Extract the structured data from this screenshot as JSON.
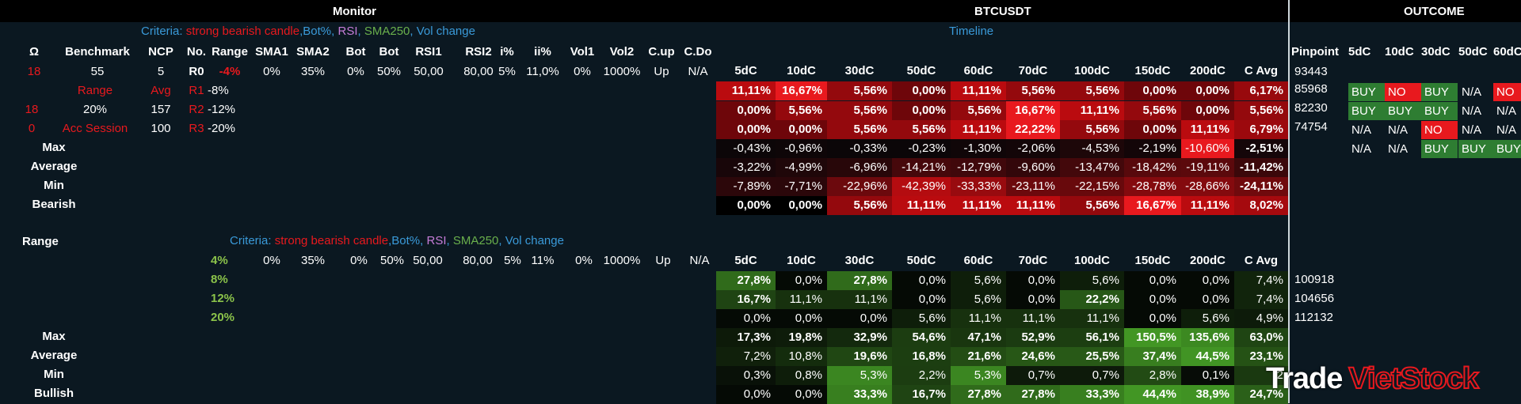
{
  "titles": {
    "monitor": "Monitor",
    "symbol": "BTCUSDT",
    "outcome": "OUTCOME",
    "timeline": "Timeline"
  },
  "criteria": {
    "prefix": "Criteria: ",
    "strong": "strong bearish candle",
    "bot": ",Bot%, ",
    "rsi": "RSI",
    "comma": ", ",
    "sma": "SMA250",
    "vol": ", Vol change"
  },
  "left_headers": [
    "Ω",
    "Benchmark",
    "NCP",
    "No.",
    "Range",
    "SMA1",
    "SMA2",
    "Bot",
    "Bot",
    "RSI1",
    "RSI2",
    "i%",
    "ii%",
    "Vol1",
    "Vol2",
    "C.up",
    "C.Do"
  ],
  "left_values": {
    "omega": "18",
    "benchmark": "55",
    "ncp": "5",
    "no": "R0",
    "range": "-4%",
    "sma1": "0%",
    "sma2": "35%",
    "bot1": "0%",
    "bot2": "50%",
    "rsi1": "50,00",
    "rsi2": "80,00",
    "i": "5%",
    "ii": "11,0%",
    "vol1": "0%",
    "vol2": "1000%",
    "cup": "Up",
    "cdo": "N/A"
  },
  "left_rows": [
    {
      "a": "Range",
      "b": "Avg",
      "no": "R1",
      "range": "-8%"
    },
    {
      "a": "18",
      "b": "20%",
      "c": "157",
      "no": "R2",
      "range": "-12%"
    },
    {
      "a": "0",
      "b": "Acc Session",
      "c": "100",
      "no": "R3",
      "range": "-20%"
    }
  ],
  "stat_labels": [
    "Max",
    "Average",
    "Min",
    "Bearish"
  ],
  "bear_headers": [
    "5dC",
    "10dC",
    "30dC",
    "50dC",
    "60dC",
    "70dC",
    "100dC",
    "150dC",
    "200dC",
    "C Avg"
  ],
  "bear_rows": [
    [
      "11,11%",
      "16,67%",
      "5,56%",
      "0,00%",
      "11,11%",
      "5,56%",
      "5,56%",
      "0,00%",
      "0,00%",
      "6,17%"
    ],
    [
      "0,00%",
      "5,56%",
      "5,56%",
      "0,00%",
      "5,56%",
      "16,67%",
      "11,11%",
      "5,56%",
      "0,00%",
      "5,56%"
    ],
    [
      "0,00%",
      "0,00%",
      "5,56%",
      "5,56%",
      "11,11%",
      "22,22%",
      "5,56%",
      "0,00%",
      "11,11%",
      "6,79%"
    ],
    [
      "-0,43%",
      "-0,96%",
      "-0,33%",
      "-0,23%",
      "-1,30%",
      "-2,06%",
      "-4,53%",
      "-2,19%",
      "-10,60%",
      "-2,51%"
    ],
    [
      "-3,22%",
      "-4,99%",
      "-6,96%",
      "-14,21%",
      "-12,79%",
      "-9,60%",
      "-13,47%",
      "-18,42%",
      "-19,11%",
      "-11,42%"
    ],
    [
      "-7,89%",
      "-7,71%",
      "-22,96%",
      "-42,39%",
      "-33,33%",
      "-23,11%",
      "-22,15%",
      "-28,78%",
      "-28,66%",
      "-24,11%"
    ],
    [
      "0,00%",
      "0,00%",
      "5,56%",
      "11,11%",
      "11,11%",
      "11,11%",
      "5,56%",
      "16,67%",
      "11,11%",
      "8,02%"
    ]
  ],
  "outcome_headers": [
    "Pinpoint",
    "5dC",
    "10dC",
    "30dC",
    "50dC",
    "60dC"
  ],
  "outcome_rows": [
    {
      "pin": "93443",
      "tags": []
    },
    {
      "pin": "85968",
      "tags": [
        "BUY",
        "NO",
        "BUY",
        "N/A",
        "NO"
      ]
    },
    {
      "pin": "82230",
      "tags": [
        "BUY",
        "BUY",
        "BUY",
        "N/A",
        "N/A"
      ]
    },
    {
      "pin": "74754",
      "tags": [
        "N/A",
        "N/A",
        "NO",
        "N/A",
        "N/A"
      ]
    },
    {
      "pin": "",
      "tags": [
        "N/A",
        "N/A",
        "BUY",
        "BUY",
        "BUY"
      ]
    }
  ],
  "bottom": {
    "range_label": "Range",
    "values": {
      "sma1": "0%",
      "sma2": "35%",
      "bot1": "0%",
      "bot2": "50%",
      "rsi1": "50,00",
      "rsi2": "80,00",
      "i": "5%",
      "ii": "11%",
      "vol1": "0%",
      "vol2": "1000%",
      "cup": "Up",
      "cdo": "N/A"
    },
    "ranges": [
      "4%",
      "8%",
      "12%",
      "20%"
    ],
    "stat_labels": [
      "Max",
      "Average",
      "Min",
      "Bullish"
    ],
    "rows": [
      [
        "27,8%",
        "0,0%",
        "27,8%",
        "0,0%",
        "5,6%",
        "0,0%",
        "5,6%",
        "0,0%",
        "0,0%",
        "7,4%"
      ],
      [
        "16,7%",
        "11,1%",
        "11,1%",
        "0,0%",
        "5,6%",
        "0,0%",
        "22,2%",
        "0,0%",
        "0,0%",
        "7,4%"
      ],
      [
        "0,0%",
        "0,0%",
        "0,0%",
        "5,6%",
        "11,1%",
        "11,1%",
        "11,1%",
        "0,0%",
        "5,6%",
        "4,9%"
      ],
      [
        "17,3%",
        "19,8%",
        "32,9%",
        "54,6%",
        "47,1%",
        "52,9%",
        "56,1%",
        "150,5%",
        "135,6%",
        "63,0%"
      ],
      [
        "7,2%",
        "10,8%",
        "19,6%",
        "16,8%",
        "21,6%",
        "24,6%",
        "25,5%",
        "37,4%",
        "44,5%",
        "23,1%"
      ],
      [
        "0,3%",
        "0,8%",
        "5,3%",
        "2,2%",
        "5,3%",
        "0,7%",
        "0,7%",
        "2,8%",
        "0,1%",
        "2"
      ],
      [
        "0,0%",
        "0,0%",
        "33,3%",
        "16,7%",
        "27,8%",
        "27,8%",
        "33,3%",
        "44,4%",
        "38,9%",
        "24,7%"
      ]
    ],
    "pinpoints": [
      "100918",
      "104656",
      "112132"
    ]
  },
  "logo": {
    "trade": "Trade",
    "vietstock": "VietStock"
  },
  "colors": {
    "red": "#e8191e",
    "blue": "#3a9ad9",
    "green": "#6ab04c",
    "buy": "#2e7d32",
    "no": "#e8191e"
  }
}
